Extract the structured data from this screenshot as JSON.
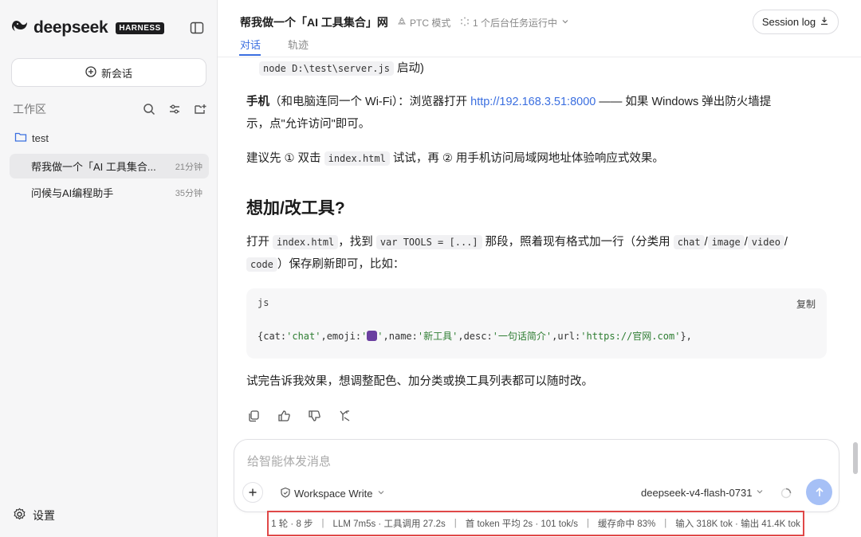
{
  "sidebar": {
    "logo_text": "deepseek",
    "logo_badge": "HARNESS",
    "new_chat": "新会话",
    "workspace_label": "工作区",
    "folder": "test",
    "sessions": [
      {
        "title": "帮我做一个「AI 工具集合...",
        "time": "21分钟"
      },
      {
        "title": "问候与AI编程助手",
        "time": "35分钟"
      }
    ],
    "settings": "设置"
  },
  "header": {
    "title": "帮我做一个「AI 工具集合」网",
    "ptc_mode": "PTC 模式",
    "background_tasks": "1 个后台任务运行中",
    "session_log": "Session log",
    "tabs": [
      "对话",
      "轨迹"
    ]
  },
  "message": {
    "line0_code": "node D:\\test\\server.js",
    "line0_tail": " 启动)",
    "phone_label": "手机",
    "phone_text1": "（和电脑连同一个 Wi-Fi）：浏览器打开 ",
    "phone_link": "http://192.168.3.51:8000",
    "phone_text2": " —— 如果 Windows 弹出防火墙提",
    "phone_text3": "示，点\"允许访问\"即可。",
    "suggest_1": "建议先 ① 双击 ",
    "suggest_code": "index.html",
    "suggest_2": " 试试，再 ② 用手机访问局域网地址体验响应式效果。",
    "heading": "想加/改工具?",
    "edit_1": "打开 ",
    "edit_code1": "index.html",
    "edit_2": "，找到 ",
    "edit_code2": "var TOOLS = [...]",
    "edit_3": " 那段，照着现有格式加一行（分类用 ",
    "cat_chat": "chat",
    "slash": "/",
    "cat_image": "image",
    "cat_video": "video",
    "cat_code": "code",
    "edit_4": "）保存刷新即可，比如：",
    "code_lang": "js",
    "code_copy": "复制",
    "code_p1": "{cat:",
    "code_s1": "'chat'",
    "code_p2": ",emoji:",
    "code_s2a": "'",
    "code_s2b": "'",
    "code_p3": ",name:",
    "code_s3": "'新工具'",
    "code_p4": ",desc:",
    "code_s4": "'一句话简介'",
    "code_p5": ",url:",
    "code_s5": "'https://官网.com'",
    "code_p6": "},",
    "closing": "试完告诉我效果，想调整配色、加分类或换工具列表都可以随时改。"
  },
  "input": {
    "placeholder": "给智能体发消息",
    "workspace_mode": "Workspace Write",
    "model": "deepseek-v4-flash-0731"
  },
  "status_bar": {
    "rounds": "1 轮 · 8 步",
    "llm": "LLM 7m5s · 工具调用 27.2s",
    "first_token": "首 token 平均 2s · 101 tok/s",
    "cache": "缓存命中 83%",
    "tokens": "输入 318K tok · 输出 41.4K tok"
  },
  "colors": {
    "accent": "#3b6fe0",
    "highlight_border": "#e04848",
    "send_button": "#a6c0f6"
  }
}
